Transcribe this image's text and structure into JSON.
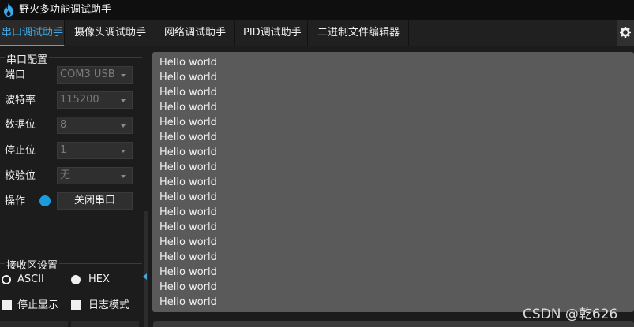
{
  "window": {
    "title": "野火多功能调试助手"
  },
  "tabs": [
    {
      "label": "串口调试助手",
      "active": true
    },
    {
      "label": "摄像头调试助手",
      "active": false
    },
    {
      "label": "网络调试助手",
      "active": false
    },
    {
      "label": "PID调试助手",
      "active": false
    },
    {
      "label": "二进制文件编辑器",
      "active": false
    }
  ],
  "settings_icon": "gear-icon",
  "serial_config": {
    "title": "串口配置",
    "port": {
      "label": "端口",
      "value": "COM3 USB"
    },
    "baud": {
      "label": "波特率",
      "value": "115200"
    },
    "databits": {
      "label": "数据位",
      "value": "8"
    },
    "stopbits": {
      "label": "停止位",
      "value": "1"
    },
    "parity": {
      "label": "校验位",
      "value": "无"
    },
    "operation": {
      "label": "操作",
      "button": "关闭串口",
      "status_color": "#1a9be0"
    }
  },
  "receive_settings": {
    "title": "接收区设置",
    "ascii": {
      "label": "ASCII",
      "selected": false
    },
    "hex": {
      "label": "HEX",
      "selected": true
    },
    "stop_display": {
      "label": "停止显示",
      "checked": false
    },
    "log_mode": {
      "label": "日志模式",
      "checked": false
    }
  },
  "receive_area": {
    "lines": [
      "Hello world",
      "Hello world",
      "Hello world",
      "Hello world",
      "Hello world",
      "Hello world",
      "Hello world",
      "Hello world",
      "Hello world",
      "Hello world",
      "Hello world",
      "Hello world",
      "Hello world",
      "Hello world",
      "Hello world",
      "Hello world",
      "Hello world"
    ]
  },
  "watermark": "CSDN @乾626",
  "colors": {
    "accent": "#3fa9e6",
    "background": "#1c1c1c",
    "receive_bg": "#5a5a5a"
  }
}
